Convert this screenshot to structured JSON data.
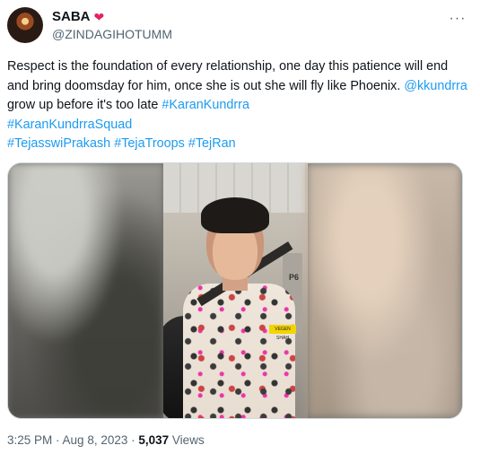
{
  "author": {
    "display_name": "SABA",
    "heart_icon": "red-heart-icon",
    "handle": "@ZINDAGIHOTUMM"
  },
  "more_icon": "more-horizontal-icon",
  "text": {
    "part1": "Respect is the foundation of every relationship, one day this patience will end and bring doomsday for him, once she is out she will fly like Phoenix. ",
    "mention": "@kkundrra",
    "part2": " grow up before it's too late ",
    "hashtag1": "#KaranKundrra",
    "hashtag2": "#KaranKundrraSquad",
    "hashtag3": "#TejasswiPrakash",
    "hashtag4": "#TejaTroops",
    "hashtag5": "#TejRan"
  },
  "media": {
    "pillar_label": "P6",
    "shirt_tag": "VEGEN SHAH"
  },
  "footer": {
    "time": "3:25 PM",
    "sep": " · ",
    "date": "Aug 8, 2023",
    "sep2": " · ",
    "views": "5,037",
    "views_label": " Views"
  },
  "colors": {
    "link": "#1d9bf0",
    "heart": "#e0245e",
    "secondary_text": "#536471"
  }
}
